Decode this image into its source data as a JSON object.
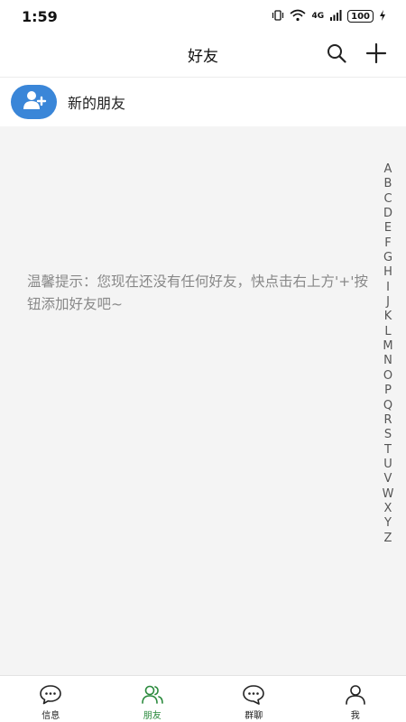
{
  "status_bar": {
    "time": "1:59",
    "network": "4G",
    "battery": "100"
  },
  "header": {
    "title": "好友"
  },
  "new_friend": {
    "label": "新的朋友"
  },
  "tip": {
    "text": "温馨提示：您现在还没有任何好友，快点击右上方'+'按钮添加好友吧~"
  },
  "index": [
    "A",
    "B",
    "C",
    "D",
    "E",
    "F",
    "G",
    "H",
    "I",
    "J",
    "K",
    "L",
    "M",
    "N",
    "O",
    "P",
    "Q",
    "R",
    "S",
    "T",
    "U",
    "V",
    "W",
    "X",
    "Y",
    "Z"
  ],
  "tabs": [
    {
      "label": "信息",
      "icon": "chat-bubble-icon",
      "active": false
    },
    {
      "label": "朋友",
      "icon": "friends-icon",
      "active": true
    },
    {
      "label": "群聊",
      "icon": "group-chat-icon",
      "active": false
    },
    {
      "label": "我",
      "icon": "person-icon",
      "active": false
    }
  ],
  "colors": {
    "accent": "#2a8a3c",
    "avatar": "#3a86d8",
    "background": "#f4f4f4"
  }
}
